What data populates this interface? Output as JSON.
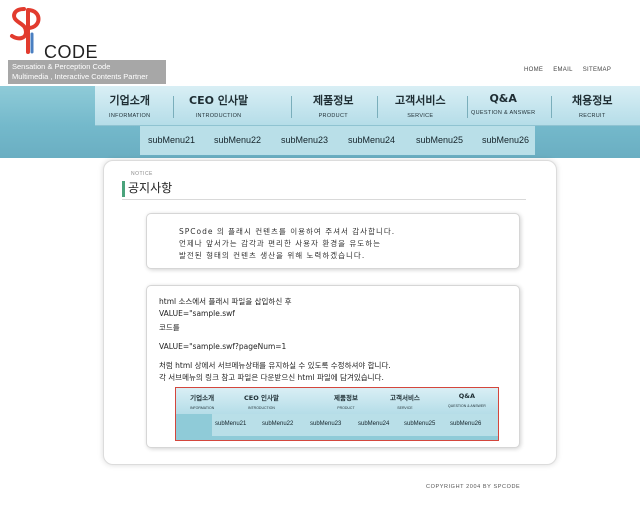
{
  "brand": {
    "name": "CODE",
    "tagline_1": "Sensation & Perception Code",
    "tagline_2": "Multimedia , Interactive Contents Partner",
    "accent_red": "#e23b2e",
    "accent_blue": "#4a7fc1"
  },
  "utility_links": [
    "HOME",
    "EMAIL",
    "SITEMAP"
  ],
  "nav": {
    "items": [
      {
        "ko": "기업소개",
        "en": "INFORMATION"
      },
      {
        "ko": "CEO 인사말",
        "en": "INTRODUCTION"
      },
      {
        "ko": "제품정보",
        "en": "PRODUCT"
      },
      {
        "ko": "고객서비스",
        "en": "SERVICE"
      },
      {
        "ko": "Q&A",
        "en": "QUESTION & ANSWER"
      },
      {
        "ko": "채용정보",
        "en": "RECRUIT"
      }
    ],
    "submenu": [
      "subMenu21",
      "subMenu22",
      "subMenu23",
      "subMenu24",
      "subMenu25",
      "subMenu26"
    ]
  },
  "notice": {
    "small_label": "NOTICE",
    "title": "공지사항"
  },
  "intro_text": [
    "SPCode 의 플래시 컨텐츠를 이용하여 주셔서 감사합니다.",
    "언제나 앞서가는 감각과 편리한 사용자 환경을  유도하는",
    "발전된 형태의 컨텐츠 생산을 위해 노력하겠습니다."
  ],
  "info_text": [
    "html 소스에서 플래시 파일을 삽입하신 후",
    "VALUE=\"sample.swf",
    "코드를",
    "VALUE=\"sample.swf?pageNum=1",
    "처럼 html 상에서 서브메뉴상태를 유지하실 수  있도록 수정하셔야 합니다.",
    "각 서브메뉴의 링크 참고 파일은 다운받으신 html 파일에 담겨있습니다."
  ],
  "mini_nav": {
    "items": [
      {
        "ko": "기업소개",
        "en": "INFORMATION"
      },
      {
        "ko": "CEO 인사말",
        "en": "INTRODUCTION"
      },
      {
        "ko": "제품정보",
        "en": "PRODUCT"
      },
      {
        "ko": "고객서비스",
        "en": "SERVICE"
      },
      {
        "ko": "Q&A",
        "en": "QUESTION & ANSWER"
      }
    ],
    "submenu": [
      "subMenu21",
      "subMenu22",
      "subMenu23",
      "subMenu24",
      "subMenu25",
      "subMenu26"
    ]
  },
  "footer": "COPYRIGHT 2004 BY SPCODE"
}
